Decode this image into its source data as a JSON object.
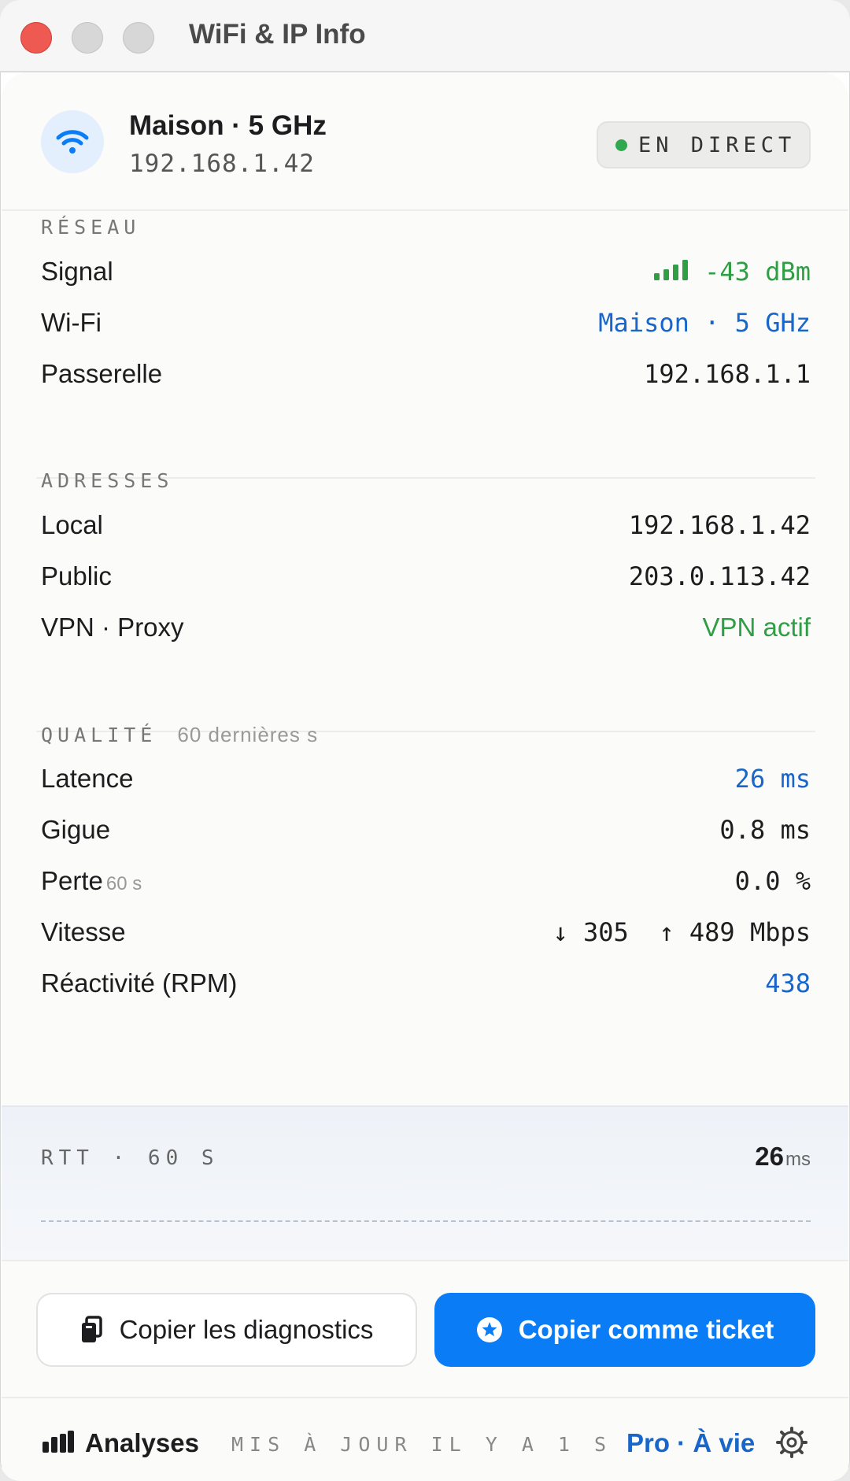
{
  "window": {
    "title": "WiFi & IP Info"
  },
  "header": {
    "network_name": "Maison · 5 GHz",
    "ip": "192.168.1.42",
    "status": "EN DIRECT",
    "status_color": "#2fa84f"
  },
  "network": {
    "section_label": "RÉSEAU",
    "signal_label": "Signal",
    "signal_value": "-43 dBm",
    "wifi_label": "Wi-Fi",
    "wifi_value": "Maison · 5 GHz",
    "gateway_label": "Passerelle",
    "gateway_value": "192.168.1.1"
  },
  "addresses": {
    "section_label": "ADRESSES",
    "local_label": "Local",
    "local_value": "192.168.1.42",
    "public_label": "Public",
    "public_value": "203.0.113.42",
    "vpn_label": "VPN · Proxy",
    "vpn_value": "VPN actif"
  },
  "quality": {
    "section_label": "QUALITÉ",
    "section_sub": "60 dernières s",
    "latency_label": "Latence",
    "latency_value": "26 ms",
    "jitter_label": "Gigue",
    "jitter_value": "0.8 ms",
    "loss_label": "Perte",
    "loss_sub": "60 s",
    "loss_value": "0.0 %",
    "speed_label": "Vitesse",
    "speed_value": "↓ 305  ↑ 489 Mbps",
    "rpm_label": "Réactivité (RPM)",
    "rpm_value": "438"
  },
  "rtt": {
    "label": "RTT · 60 S",
    "value": "26",
    "unit": "ms"
  },
  "actions": {
    "copy_diagnostics": "Copier les diagnostics",
    "copy_ticket": "Copier comme ticket"
  },
  "footer": {
    "analyses": "Analyses",
    "updated": "MIS À JOUR IL Y A 1 S",
    "pro": "Pro · À vie"
  },
  "colors": {
    "accent": "#0a7cf5",
    "link": "#1866c9",
    "good": "#2f9e44"
  },
  "icons": [
    "wifi-icon",
    "signal-bars-icon",
    "clipboard-icon",
    "star-badge-icon",
    "bar-chart-icon",
    "gear-icon"
  ]
}
